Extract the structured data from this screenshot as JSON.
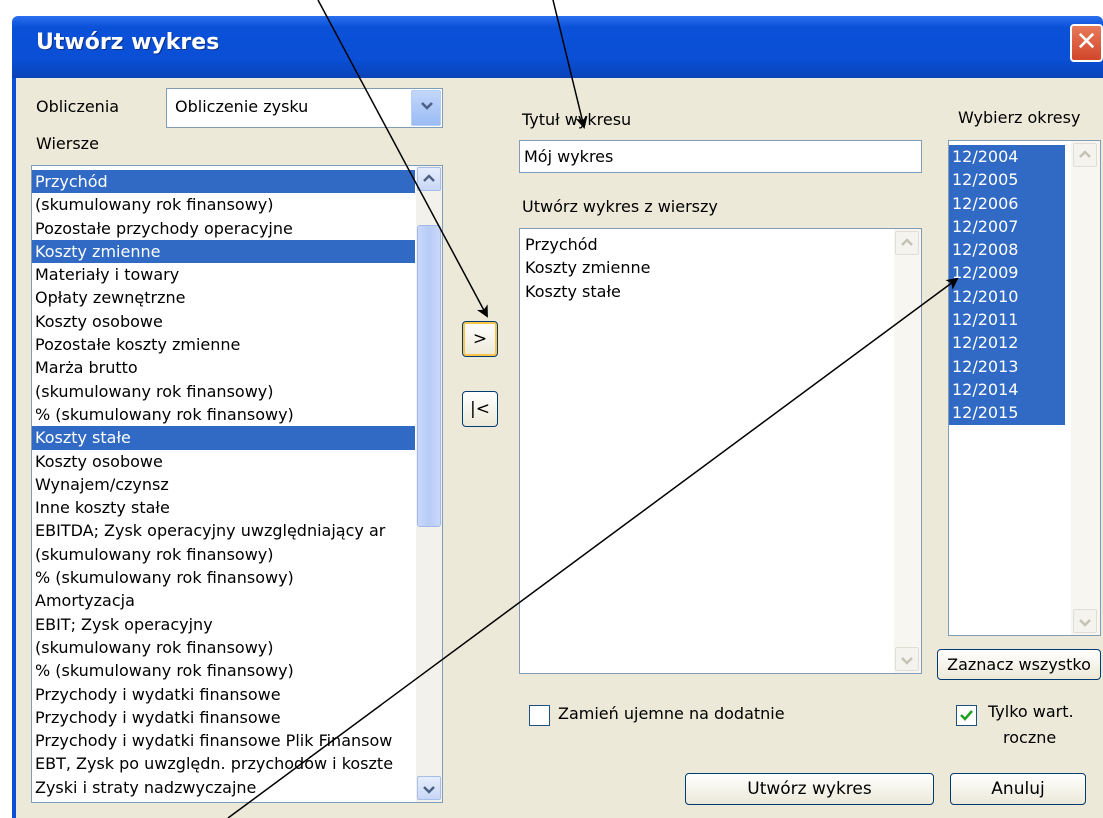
{
  "window": {
    "title": "Utwórz wykres",
    "close_symbol": "✕"
  },
  "left": {
    "calc_label": "Obliczenia",
    "calc_value": "Obliczenie zysku",
    "rows_label": "Wiersze",
    "rows": [
      {
        "text": "Przychód",
        "selected": true
      },
      {
        "text": "(skumulowany rok finansowy)",
        "selected": false
      },
      {
        "text": "Pozostałe przychody operacyjne",
        "selected": false
      },
      {
        "text": "Koszty zmienne",
        "selected": true
      },
      {
        "text": "Materiały i towary",
        "selected": false
      },
      {
        "text": "Opłaty zewnętrzne",
        "selected": false
      },
      {
        "text": "Koszty osobowe",
        "selected": false
      },
      {
        "text": "Pozostałe koszty zmienne",
        "selected": false
      },
      {
        "text": "Marża brutto",
        "selected": false
      },
      {
        "text": "(skumulowany rok finansowy)",
        "selected": false
      },
      {
        "text": "% (skumulowany rok finansowy)",
        "selected": false
      },
      {
        "text": "Koszty stałe",
        "selected": true
      },
      {
        "text": "Koszty osobowe",
        "selected": false
      },
      {
        "text": "Wynajem/czynsz",
        "selected": false
      },
      {
        "text": "Inne koszty stałe",
        "selected": false
      },
      {
        "text": "EBITDA; Zysk operacyjny uwzględniający ar",
        "selected": false
      },
      {
        "text": "(skumulowany rok finansowy)",
        "selected": false
      },
      {
        "text": "% (skumulowany rok finansowy)",
        "selected": false
      },
      {
        "text": "Amortyzacja",
        "selected": false
      },
      {
        "text": "EBIT; Zysk operacyjny",
        "selected": false
      },
      {
        "text": "(skumulowany rok finansowy)",
        "selected": false
      },
      {
        "text": "% (skumulowany rok finansowy)",
        "selected": false
      },
      {
        "text": "Przychody i wydatki finansowe",
        "selected": false
      },
      {
        "text": "Przychody i wydatki finansowe",
        "selected": false
      },
      {
        "text": "Przychody i wydatki finansowe Plik Finansow",
        "selected": false
      },
      {
        "text": "EBT, Zysk po uwzględn. przychodów i koszte",
        "selected": false
      },
      {
        "text": "Zyski i straty nadzwyczajne",
        "selected": false
      }
    ]
  },
  "middle": {
    "add_label": ">",
    "remove_label": "|<"
  },
  "center": {
    "title_label": "Tytuł wykresu",
    "title_value": "Mój wykres",
    "chart_rows_label": "Utwórz wykres z wierszy",
    "chart_rows": [
      "Przychód",
      "Koszty zmienne",
      "Koszty stałe"
    ],
    "negate_label": "Zamień ujemne na dodatnie",
    "negate_checked": false,
    "create_button": "Utwórz wykres"
  },
  "right": {
    "periods_label": "Wybierz okresy",
    "periods": [
      "12/2004",
      "12/2005",
      "12/2006",
      "12/2007",
      "12/2008",
      "12/2009",
      "12/2010",
      "12/2011",
      "12/2012",
      "12/2013",
      "12/2014",
      "12/2015"
    ],
    "select_all_button": "Zaznacz wszystko",
    "annual_label_line1": "Tylko wart.",
    "annual_label_line2": "roczne",
    "annual_checked": true,
    "cancel_button": "Anuluj"
  },
  "colors": {
    "selection": "#316ac5",
    "titlebar": "#0a4fd6",
    "dialog_bg": "#ece9d8"
  }
}
